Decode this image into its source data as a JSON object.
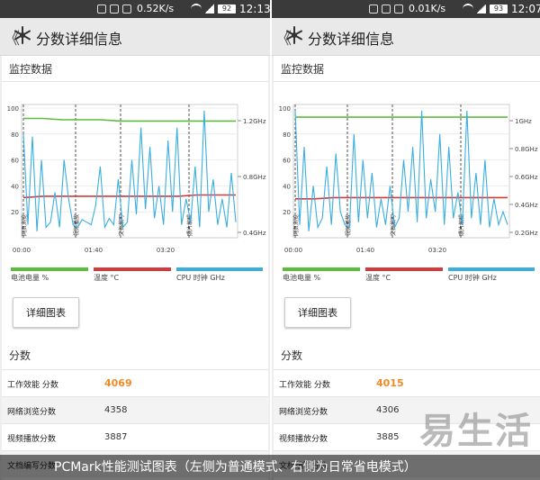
{
  "panels": [
    {
      "status": {
        "speed": "0.52K/s",
        "battery": "92",
        "time": "12:13"
      },
      "header": {
        "back": "《",
        "title": "分数详细信息"
      },
      "monitor_title": "监控数据",
      "chart_data": {
        "type": "line",
        "xticks": [
          "00:00",
          "01:40",
          "03:20"
        ],
        "yticks_left": [
          "100",
          "80",
          "60",
          "40",
          "20"
        ],
        "yticks_right": [
          "1.2GHz",
          "0.8GHz",
          "0.4GHz"
        ],
        "ylim": [
          0,
          100
        ],
        "phases": [
          "网页浏览",
          "视频播放",
          "文档编写",
          "照片编辑"
        ],
        "series": [
          {
            "name": "电池电量 %",
            "color": "#5cbd3c",
            "values": [
              92,
              92,
              91,
              91,
              91,
              90,
              90,
              90,
              90,
              90,
              90,
              90
            ]
          },
          {
            "name": "温度 °C",
            "color": "#d13b3b",
            "values": [
              31,
              32,
              32,
              32,
              32,
              32,
              32,
              32,
              32,
              33,
              33,
              33
            ]
          },
          {
            "name": "CPU 时钟 GHz",
            "color": "#3aaee0",
            "values": [
              80,
              10,
              78,
              5,
              60,
              8,
              12,
              35,
              8,
              60,
              30,
              10,
              8,
              14,
              12,
              10,
              25,
              55,
              8,
              15,
              10,
              45,
              8,
              12,
              60,
              18,
              85,
              22,
              70,
              15,
              40,
              10,
              75,
              20,
              85,
              10,
              30,
              12,
              55,
              8,
              98,
              20,
              45,
              10,
              30,
              8,
              50,
              12
            ]
          }
        ]
      },
      "detail_button": "详细图表",
      "score_title": "分数",
      "scores": [
        {
          "label": "工作效能 分数",
          "value": "4069"
        },
        {
          "label": "网络浏览分数",
          "value": "4358"
        },
        {
          "label": "视频播放分数",
          "value": "3887"
        },
        {
          "label": "文档编写分数",
          "value": ""
        }
      ]
    },
    {
      "status": {
        "speed": "0.01K/s",
        "battery": "93",
        "time": "12:07"
      },
      "header": {
        "back": "《",
        "title": "分数详细信息"
      },
      "monitor_title": "监控数据",
      "chart_data": {
        "type": "line",
        "xticks": [
          "00:00",
          "01:40",
          "03:20"
        ],
        "yticks_left": [
          "100",
          "80",
          "60",
          "40",
          "20"
        ],
        "yticks_right": [
          "1GHz",
          "0.8GHz",
          "0.6GHz",
          "0.4GHz",
          "0.2GHz"
        ],
        "ylim": [
          0,
          100
        ],
        "phases": [
          "网页浏览",
          "视频播放",
          "文档编写",
          "照片编辑"
        ],
        "series": [
          {
            "name": "电池电量 %",
            "color": "#5cbd3c",
            "values": [
              93,
              93,
              93,
              93,
              93,
              93,
              93,
              93,
              93,
              93,
              93,
              93
            ]
          },
          {
            "name": "温度 °C",
            "color": "#d13b3b",
            "values": [
              30,
              30,
              31,
              31,
              31,
              31,
              31,
              31,
              31,
              31,
              31,
              31
            ]
          },
          {
            "name": "CPU 时钟 GHz",
            "color": "#3aaee0",
            "values": [
              98,
              10,
              70,
              5,
              40,
              8,
              15,
              55,
              10,
              65,
              20,
              10,
              8,
              80,
              12,
              60,
              15,
              50,
              8,
              30,
              10,
              40,
              8,
              15,
              60,
              20,
              70,
              12,
              98,
              15,
              45,
              20,
              80,
              10,
              70,
              15,
              35,
              10,
              98,
              15,
              50,
              10,
              60,
              8,
              30,
              10,
              20,
              10
            ]
          }
        ]
      },
      "detail_button": "详细图表",
      "score_title": "分数",
      "scores": [
        {
          "label": "工作效能 分数",
          "value": "4015"
        },
        {
          "label": "网络浏览分数",
          "value": "4306"
        },
        {
          "label": "视频播放分数",
          "value": "3885"
        },
        {
          "label": "文档编写分数",
          "value": ""
        }
      ]
    }
  ],
  "caption": "PCMark性能测试图表（左侧为普通模式、右侧为日常省电模式）",
  "watermark": "易生活"
}
